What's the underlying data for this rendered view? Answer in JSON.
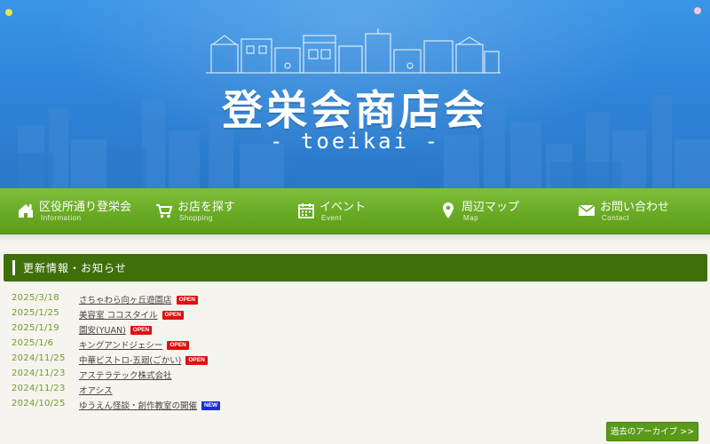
{
  "header": {
    "logo_title": "登栄会商店会",
    "logo_subtitle": "- toeikai -"
  },
  "nav": {
    "items": [
      {
        "label": "区役所通り登栄会",
        "sub": "Information",
        "icon": "home-icon"
      },
      {
        "label": "お店を探す",
        "sub": "Shopping",
        "icon": "cart-icon"
      },
      {
        "label": "イベント",
        "sub": "Event",
        "icon": "calendar-icon"
      },
      {
        "label": "周辺マップ",
        "sub": "Map",
        "icon": "map-pin-icon"
      },
      {
        "label": "お問い合わせ",
        "sub": "Contact",
        "icon": "mail-icon"
      }
    ]
  },
  "news": {
    "heading": "更新情報・お知らせ",
    "items": [
      {
        "date": "2025/3/18",
        "title": "さちゃわら向ヶ丘遊園店",
        "badge": "OPEN"
      },
      {
        "date": "2025/1/25",
        "title": "美容室 ココスタイル",
        "badge": "OPEN"
      },
      {
        "date": "2025/1/19",
        "title": "園安(YUAN)",
        "badge": "OPEN"
      },
      {
        "date": "2025/1/6",
        "title": "キングアンドジェシー",
        "badge": "OPEN"
      },
      {
        "date": "2024/11/25",
        "title": "中華ビストロ-五廻(ごかい)",
        "badge": "OPEN"
      },
      {
        "date": "2024/11/23",
        "title": "アステラテック株式会社",
        "badge": ""
      },
      {
        "date": "2024/11/23",
        "title": "オアシス",
        "badge": ""
      },
      {
        "date": "2024/10/25",
        "title": "ゆうえん怪談・創作教室の開催",
        "badge": "NEW"
      }
    ],
    "archive_label": "過去のアーカイブ >>"
  },
  "colors": {
    "sky": "#2f86da",
    "nav_green": "#69ab25",
    "heading_green": "#3f6f0a",
    "date_green": "#6f9c2c",
    "badge_open": "#e01010",
    "badge_new": "#1a2ce6"
  }
}
